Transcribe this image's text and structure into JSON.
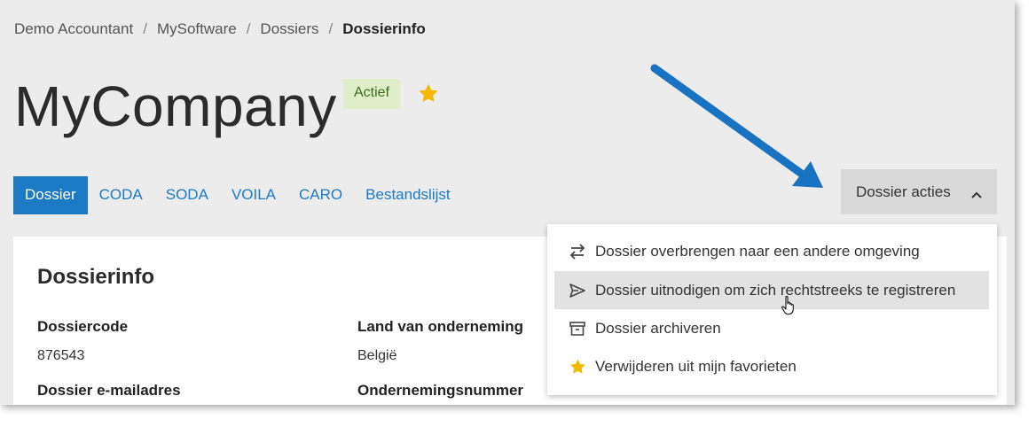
{
  "breadcrumb": {
    "items": [
      "Demo Accountant",
      "MySoftware",
      "Dossiers"
    ],
    "current": "Dossierinfo",
    "separator": "/"
  },
  "header": {
    "title": "MyCompany",
    "status_badge": "Actief",
    "favorite_icon": "star-icon"
  },
  "tabs": [
    {
      "label": "Dossier",
      "active": true
    },
    {
      "label": "CODA",
      "active": false
    },
    {
      "label": "SODA",
      "active": false
    },
    {
      "label": "VOILA",
      "active": false
    },
    {
      "label": "CARO",
      "active": false
    },
    {
      "label": "Bestandslijst",
      "active": false
    }
  ],
  "actions": {
    "label": "Dossier acties",
    "icon": "chevron-up-icon",
    "menu": [
      {
        "label": "Dossier overbrengen naar een andere omgeving",
        "icon": "transfer-arrows-icon"
      },
      {
        "label": "Dossier uitnodigen om zich rechtstreeks te registreren",
        "icon": "send-icon",
        "hovered": true
      },
      {
        "label": "Dossier archiveren",
        "icon": "archive-icon"
      },
      {
        "label": "Verwijderen uit mijn favorieten",
        "icon": "star-icon"
      }
    ]
  },
  "card": {
    "title": "Dossierinfo",
    "fields": [
      {
        "label": "Dossiercode",
        "value": "876543"
      },
      {
        "label": "Land van onderneming",
        "value": "België"
      },
      {
        "label": "Dossier e-mailadres",
        "value": ""
      },
      {
        "label": "Ondernemingsnummer",
        "value": ""
      }
    ]
  },
  "colors": {
    "accent": "#1c7ac4",
    "badge_bg": "#dfeec9",
    "badge_text": "#3d6b1a",
    "star": "#f5b800",
    "annotation_arrow": "#1a73c2"
  }
}
